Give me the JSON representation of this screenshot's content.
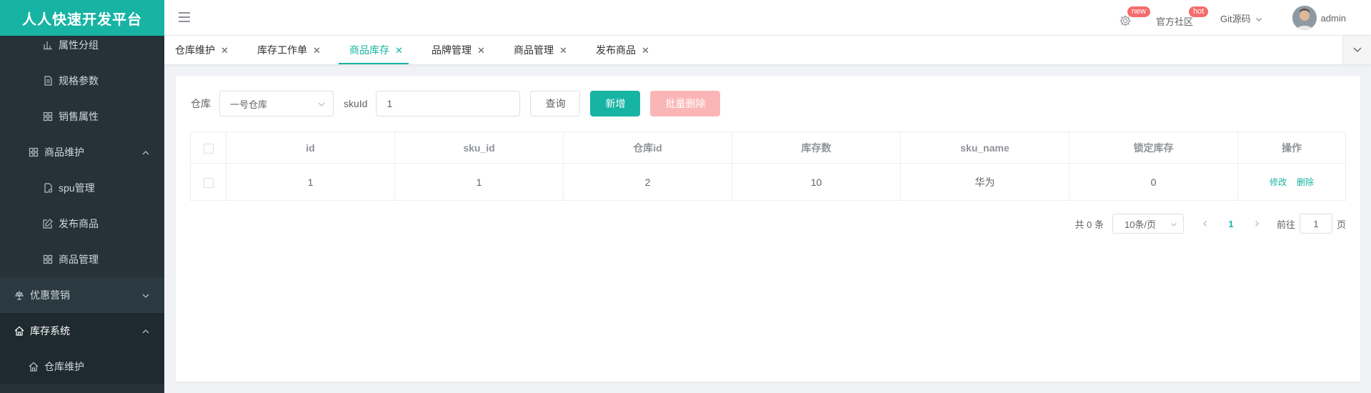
{
  "app": {
    "title": "人人快速开发平台"
  },
  "sidebar": {
    "items": [
      {
        "label": "属性分组",
        "icon": "bar-chart-icon",
        "level": 3
      },
      {
        "label": "规格参数",
        "icon": "document-icon",
        "level": 3
      },
      {
        "label": "销售属性",
        "icon": "grid-icon",
        "level": 3
      },
      {
        "label": "商品维护",
        "icon": "grid-icon",
        "level": 2,
        "expanded": true
      },
      {
        "label": "spu管理",
        "icon": "document-gear-icon",
        "level": 3
      },
      {
        "label": "发布商品",
        "icon": "edit-icon",
        "level": 3
      },
      {
        "label": "商品管理",
        "icon": "grid-icon",
        "level": 3
      },
      {
        "label": "优惠营销",
        "icon": "coupon-icon",
        "level": 1,
        "expanded": false
      },
      {
        "label": "库存系统",
        "icon": "home-icon",
        "level": 1,
        "expanded": true
      },
      {
        "label": "仓库维护",
        "icon": "home-icon",
        "level": 2
      }
    ]
  },
  "navbar": {
    "settings_badge": "new",
    "community_label": "官方社区",
    "community_badge": "hot",
    "git_label": "Git源码",
    "user_name": "admin"
  },
  "tabs": [
    {
      "label": "仓库维护",
      "active": false
    },
    {
      "label": "库存工作单",
      "active": false
    },
    {
      "label": "商品库存",
      "active": true
    },
    {
      "label": "品牌管理",
      "active": false
    },
    {
      "label": "商品管理",
      "active": false
    },
    {
      "label": "发布商品",
      "active": false
    }
  ],
  "filter": {
    "warehouse_label": "仓库",
    "warehouse_value": "一号仓库",
    "skuid_label": "skuId",
    "skuid_value": "1",
    "query_button": "查询",
    "add_button": "新增",
    "batch_delete_button": "批量删除"
  },
  "table": {
    "headers": [
      "id",
      "sku_id",
      "仓库id",
      "库存数",
      "sku_name",
      "锁定库存",
      "操作"
    ],
    "rows": [
      {
        "id": "1",
        "sku_id": "1",
        "ware_id": "2",
        "stock": "10",
        "sku_name": "华为",
        "stock_locked": "0",
        "edit": "修改",
        "delete": "删除"
      }
    ]
  },
  "pagination": {
    "total_text": "共 0 条",
    "page_size": "10条/页",
    "current_page": "1",
    "goto_label": "前往",
    "goto_value": "1",
    "page_suffix": "页"
  },
  "colors": {
    "accent": "#17b3a3",
    "sidebar_bg": "#263238",
    "danger_light": "#fab6b6",
    "badge": "#f56c6c"
  }
}
